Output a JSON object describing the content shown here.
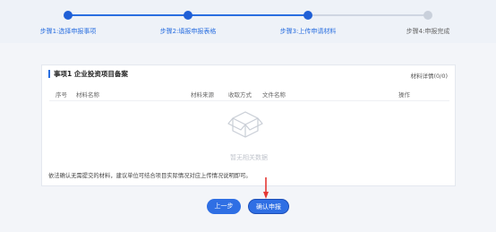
{
  "steps": [
    {
      "label": "步骤1:选择申报事项",
      "state": "done"
    },
    {
      "label": "步骤2:填报申报表格",
      "state": "done"
    },
    {
      "label": "步骤3:上传申请材料",
      "state": "done"
    },
    {
      "label": "步骤4:申报完成",
      "state": "todo"
    }
  ],
  "panel": {
    "title": "事项1 企业投资项目备案",
    "detail_link": "材料详情(0/0)",
    "columns": {
      "index": "序号",
      "name": "材料名称",
      "source": "材料来源",
      "method": "收取方式",
      "file": "文件名称",
      "action": "操作"
    },
    "empty_text": "暂无相关数据",
    "note": "依法确认无需提交的材料，建议单位可结合项目实际情况对应上传情况说明即可。"
  },
  "buttons": {
    "prev": "上一步",
    "submit": "确认申报"
  },
  "colors": {
    "accent": "#2a6fe0",
    "arrow": "#e53935"
  }
}
